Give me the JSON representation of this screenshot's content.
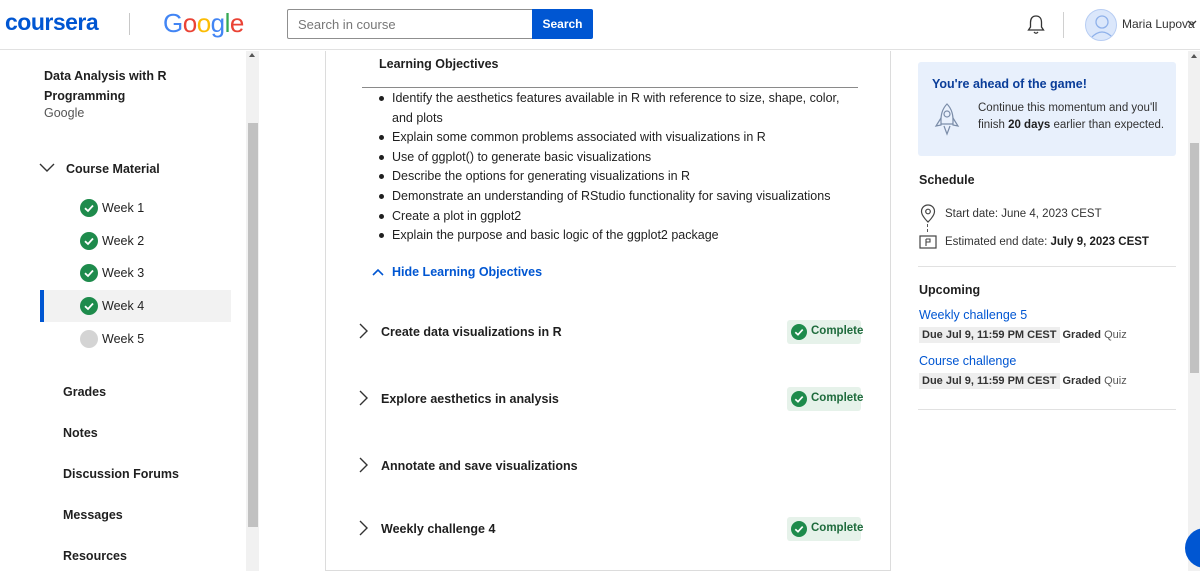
{
  "header": {
    "brand": "coursera",
    "partner": "Google",
    "search_placeholder": "Search in course",
    "search_button": "Search",
    "user_name": "Maria Lupova",
    "colors": {
      "brand_blue": "#0056d2",
      "success_green": "#1e8b4c"
    }
  },
  "sidebar": {
    "course_title": "Data Analysis with R Programming",
    "course_org": "Google",
    "section_label": "Course Material",
    "weeks": [
      {
        "label": "Week 1",
        "status": "complete"
      },
      {
        "label": "Week 2",
        "status": "complete"
      },
      {
        "label": "Week 3",
        "status": "complete"
      },
      {
        "label": "Week 4",
        "status": "complete"
      },
      {
        "label": "Week 5",
        "status": "incomplete"
      }
    ],
    "nav": [
      "Grades",
      "Notes",
      "Discussion Forums",
      "Messages",
      "Resources"
    ]
  },
  "main": {
    "objectives_title": "Learning Objectives",
    "objectives": [
      "Identify the aesthetics features available in R with reference to size, shape, color, and plots",
      "Explain some common problems associated with visualizations in R",
      "Use of ggplot() to generate basic visualizations",
      "Describe the options for generating visualizations in R",
      "Demonstrate an understanding of RStudio functionality for saving visualizations",
      "Create a plot in ggplot2",
      "Explain the purpose and basic logic of the ggplot2 package"
    ],
    "hide_objectives": "Hide Learning Objectives",
    "modules": [
      {
        "title": "Create data visualizations in R",
        "status": "Complete"
      },
      {
        "title": "Explore aesthetics in analysis",
        "status": "Complete"
      },
      {
        "title": "Annotate and save visualizations",
        "status": ""
      },
      {
        "title": "Weekly challenge 4",
        "status": "Complete"
      }
    ]
  },
  "right": {
    "ahead_title": "You're ahead of the game!",
    "ahead_text_1": "Continue this momentum and you'll finish",
    "ahead_days": "20 days",
    "ahead_text_2": "earlier than expected.",
    "schedule_title": "Schedule",
    "start_date": "Start date: June 4, 2023 CEST",
    "end_label": "Estimated end date:",
    "end_date": "July 9, 2023 CEST",
    "upcoming_title": "Upcoming",
    "upcoming": [
      {
        "title": "Weekly challenge 5",
        "due": "Due Jul 9, 11:59 PM CEST",
        "graded": "Graded",
        "type": "Quiz"
      },
      {
        "title": "Course challenge",
        "due": "Due Jul 9, 11:59 PM CEST",
        "graded": "Graded",
        "type": "Quiz"
      }
    ]
  }
}
